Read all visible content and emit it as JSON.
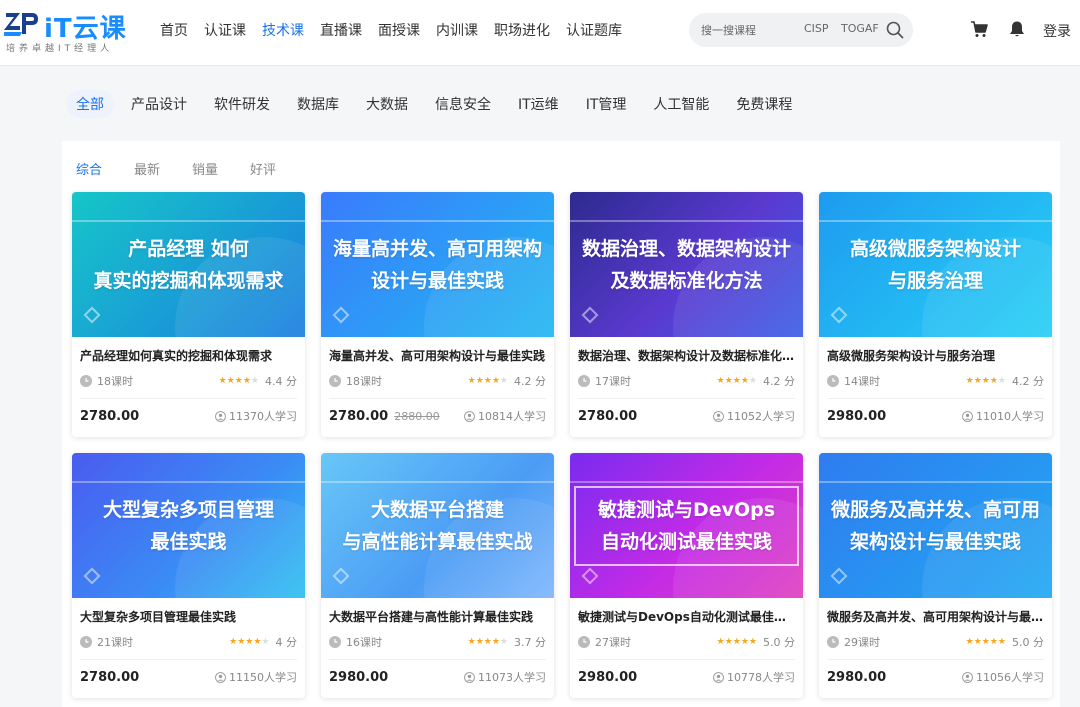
{
  "logo": {
    "text": "iT云课",
    "subtitle": "培养卓越IT经理人",
    "brand_color": "#1a8cff"
  },
  "nav": {
    "items": [
      {
        "label": "首页",
        "active": false
      },
      {
        "label": "认证课",
        "active": false
      },
      {
        "label": "技术课",
        "active": true
      },
      {
        "label": "直播课",
        "active": false
      },
      {
        "label": "面授课",
        "active": false
      },
      {
        "label": "内训课",
        "active": false
      },
      {
        "label": "职场进化",
        "active": false
      },
      {
        "label": "认证题库",
        "active": false
      }
    ]
  },
  "search": {
    "placeholder": "搜一搜课程",
    "tags": [
      "CISP",
      "TOGAF"
    ],
    "icon": "search-icon"
  },
  "header_actions": {
    "cart_icon": "cart-icon",
    "bell_icon": "bell-icon",
    "login_label": "登录"
  },
  "categories": [
    {
      "label": "全部",
      "active": true
    },
    {
      "label": "产品设计",
      "active": false
    },
    {
      "label": "软件研发",
      "active": false
    },
    {
      "label": "数据库",
      "active": false
    },
    {
      "label": "大数据",
      "active": false
    },
    {
      "label": "信息安全",
      "active": false
    },
    {
      "label": "IT运维",
      "active": false
    },
    {
      "label": "IT管理",
      "active": false
    },
    {
      "label": "人工智能",
      "active": false
    },
    {
      "label": "免费课程",
      "active": false
    }
  ],
  "sort_tabs": [
    {
      "label": "综合",
      "active": true
    },
    {
      "label": "最新",
      "active": false
    },
    {
      "label": "销量",
      "active": false
    },
    {
      "label": "好评",
      "active": false
    }
  ],
  "accent_color": "#1a73e8",
  "star_color": "#f5a623",
  "courses": [
    {
      "cover_lines": [
        "产品经理 如何",
        "真实的挖掘和体现需求"
      ],
      "cover_bg": "linear-gradient(135deg,#16c6c8 0%,#1b7fe0 100%)",
      "boxed": false,
      "title": "产品经理如何真实的挖掘和体现需求",
      "lessons": "18课时",
      "rating": 4.4,
      "score": "4.4 分",
      "price": "2780.00",
      "old_price": "",
      "learners": "11370人学习"
    },
    {
      "cover_lines": [
        "海量高并发、高可用架构",
        "设计与最佳实践"
      ],
      "cover_bg": "linear-gradient(135deg,#3a7bfd 0%,#22b8f0 100%)",
      "boxed": false,
      "title": "海量高并发、高可用架构设计与最佳实践",
      "lessons": "18课时",
      "rating": 4.2,
      "score": "4.2 分",
      "price": "2780.00",
      "old_price": "2880.00",
      "learners": "10814人学习"
    },
    {
      "cover_lines": [
        "数据治理、数据架构设计",
        "及数据标准化方法"
      ],
      "cover_bg": "linear-gradient(135deg,#2d2a8f 0%,#5a3ad0 55%,#3b5fe6 100%)",
      "boxed": false,
      "title": "数据治理、数据架构设计及数据标准化方法",
      "lessons": "17课时",
      "rating": 4.2,
      "score": "4.2 分",
      "price": "2780.00",
      "old_price": "",
      "learners": "11052人学习"
    },
    {
      "cover_lines": [
        "高级微服务架构设计",
        "与服务治理"
      ],
      "cover_bg": "linear-gradient(135deg,#1e9bf0 0%,#27d0f5 100%)",
      "boxed": false,
      "title": "高级微服务架构设计与服务治理",
      "lessons": "14课时",
      "rating": 4.2,
      "score": "4.2 分",
      "price": "2980.00",
      "old_price": "",
      "learners": "11010人学习"
    },
    {
      "cover_lines": [
        "大型复杂多项目管理",
        "最佳实践"
      ],
      "cover_bg": "linear-gradient(135deg,#4a5cf0 0%,#3a8df5 60%,#2fc0f0 100%)",
      "boxed": false,
      "title": "大型复杂多项目管理最佳实践",
      "lessons": "21课时",
      "rating": 4,
      "score": "4 分",
      "price": "2780.00",
      "old_price": "",
      "learners": "11150人学习"
    },
    {
      "cover_lines": [
        "大数据平台搭建",
        "与高性能计算最佳实战"
      ],
      "cover_bg": "linear-gradient(135deg,#68c7f7 0%,#4b9cf5 60%,#7fb7fb 100%)",
      "boxed": false,
      "title": "大数据平台搭建与高性能计算最佳实践",
      "lessons": "16课时",
      "rating": 3.7,
      "score": "3.7 分",
      "price": "2980.00",
      "old_price": "",
      "learners": "11073人学习"
    },
    {
      "cover_lines": [
        "敏捷测试与DevOps",
        "自动化测试最佳实践"
      ],
      "cover_bg": "linear-gradient(135deg,#7a2bf0 0%,#c32be6 55%,#e040c0 100%)",
      "boxed": true,
      "title": "敏捷测试与DevOps自动化测试最佳实践",
      "lessons": "27课时",
      "rating": 5,
      "score": "5.0 分",
      "price": "2980.00",
      "old_price": "",
      "learners": "10778人学习"
    },
    {
      "cover_lines": [
        "微服务及高并发、高可用",
        "架构设计与最佳实践"
      ],
      "cover_bg": "linear-gradient(135deg,#2f7cf0 0%,#22a8f2 100%)",
      "boxed": false,
      "title": "微服务及高并发、高可用架构设计与最佳实践",
      "lessons": "29课时",
      "rating": 5,
      "score": "5.0 分",
      "price": "2980.00",
      "old_price": "",
      "learners": "11056人学习"
    }
  ]
}
